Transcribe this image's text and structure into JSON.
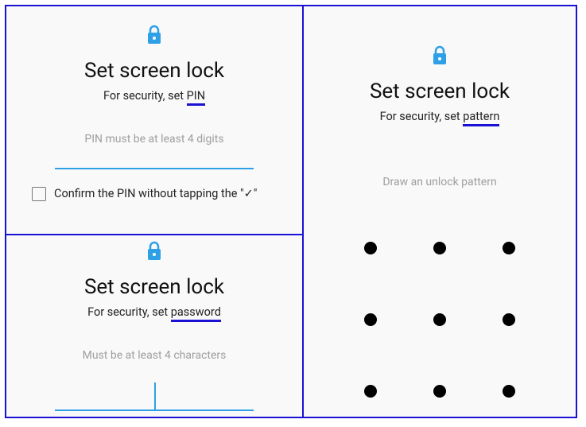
{
  "colors": {
    "accent": "#1a11d4",
    "input_line": "#2ea0e6",
    "icon": "#2ea0e6"
  },
  "pin": {
    "title": "Set screen lock",
    "subtitle_prefix": "For security, set ",
    "subtitle_highlight": "PIN",
    "helper": "PIN must be at least 4 digits",
    "confirm_label": "Confirm the PIN without tapping the \"✓\"",
    "confirm_checked": false,
    "input_value": ""
  },
  "password": {
    "title": "Set screen lock",
    "subtitle_prefix": "For security, set ",
    "subtitle_highlight": "password",
    "helper": "Must be at least 4 characters",
    "input_value": ""
  },
  "pattern": {
    "title": "Set screen lock",
    "subtitle_prefix": "For security, set ",
    "subtitle_highlight": "pattern",
    "helper": "Draw an unlock pattern",
    "grid_size": 3
  }
}
